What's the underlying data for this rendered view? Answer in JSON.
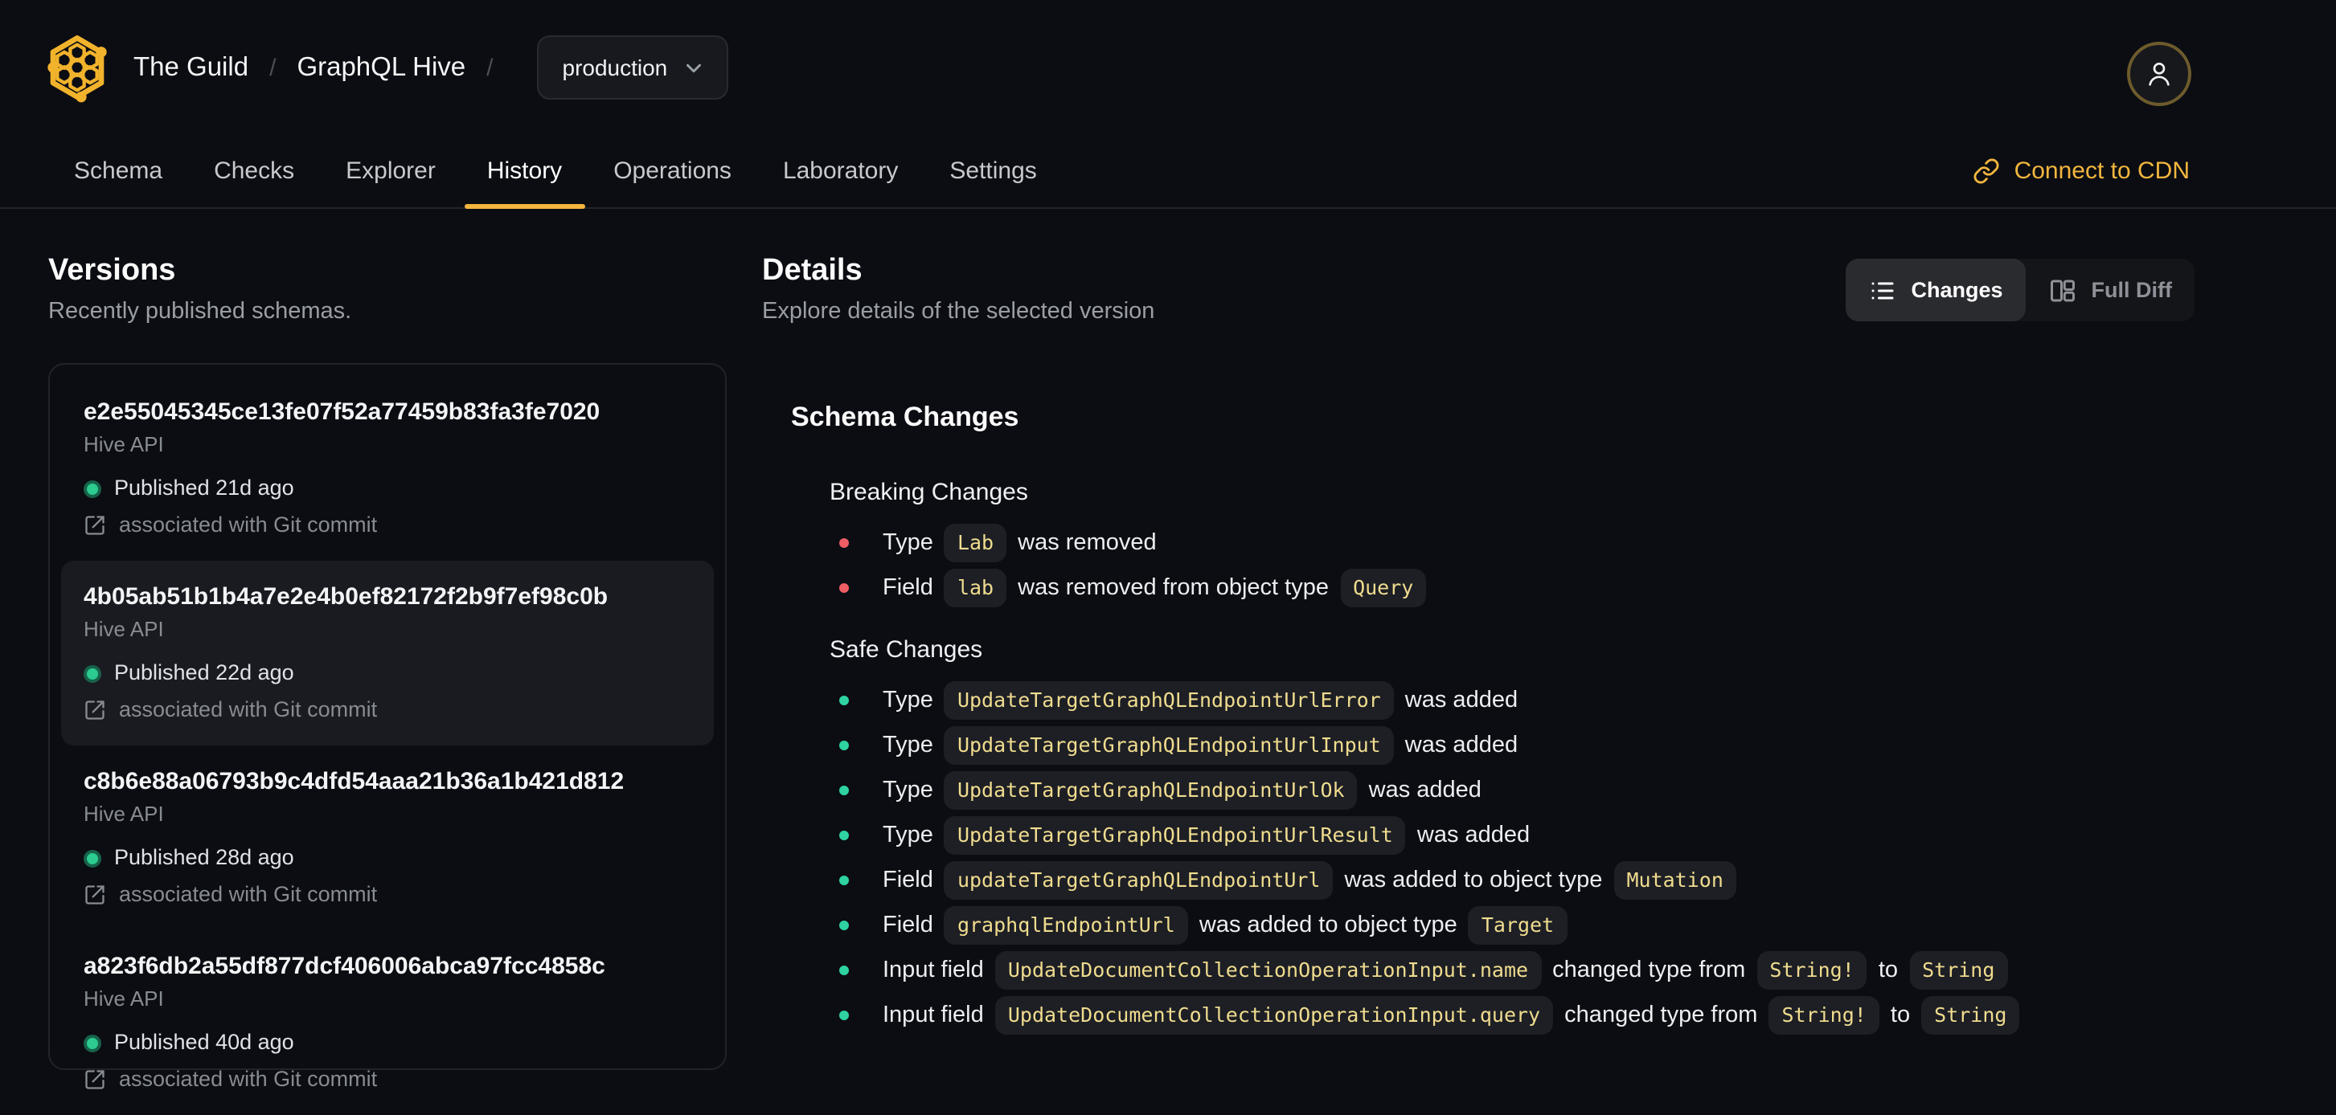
{
  "header": {
    "org": "The Guild",
    "separator": "/",
    "project": "GraphQL Hive",
    "target_selector": {
      "value": "production"
    }
  },
  "nav": {
    "tabs": [
      "Schema",
      "Checks",
      "Explorer",
      "History",
      "Operations",
      "Laboratory",
      "Settings"
    ],
    "active_tab": "History",
    "cdn_link_label": "Connect to CDN"
  },
  "versions": {
    "title": "Versions",
    "subtitle": "Recently published schemas.",
    "items": [
      {
        "hash": "e2e55045345ce13fe07f52a77459b83fa3fe7020",
        "service": "Hive API",
        "status": "Published 21d ago",
        "git": "associated with Git commit",
        "selected": false
      },
      {
        "hash": "4b05ab51b1b4a7e2e4b0ef82172f2b9f7ef98c0b",
        "service": "Hive API",
        "status": "Published 22d ago",
        "git": "associated with Git commit",
        "selected": true
      },
      {
        "hash": "c8b6e88a06793b9c4dfd54aaa21b36a1b421d812",
        "service": "Hive API",
        "status": "Published 28d ago",
        "git": "associated with Git commit",
        "selected": false
      },
      {
        "hash": "a823f6db2a55df877dcf406006abca97fcc4858c",
        "service": "Hive API",
        "status": "Published 40d ago",
        "git": "associated with Git commit",
        "selected": false
      }
    ]
  },
  "details": {
    "title": "Details",
    "subtitle": "Explore details of the selected version",
    "view_toggle": [
      {
        "label": "Changes",
        "icon": "list-icon",
        "active": true
      },
      {
        "label": "Full Diff",
        "icon": "split-panels-icon",
        "active": false
      }
    ],
    "schema_changes": {
      "title": "Schema Changes",
      "sections": [
        {
          "title": "Breaking Changes",
          "kind": "breaking",
          "items": [
            [
              {
                "text": "Type "
              },
              {
                "code": "Lab"
              },
              {
                "text": " was removed"
              }
            ],
            [
              {
                "text": "Field "
              },
              {
                "code": "lab"
              },
              {
                "text": " was removed from object type "
              },
              {
                "code": "Query"
              }
            ]
          ]
        },
        {
          "title": "Safe Changes",
          "kind": "safe",
          "items": [
            [
              {
                "text": "Type "
              },
              {
                "code": "UpdateTargetGraphQLEndpointUrlError"
              },
              {
                "text": " was added"
              }
            ],
            [
              {
                "text": "Type "
              },
              {
                "code": "UpdateTargetGraphQLEndpointUrlInput"
              },
              {
                "text": " was added"
              }
            ],
            [
              {
                "text": "Type "
              },
              {
                "code": "UpdateTargetGraphQLEndpointUrlOk"
              },
              {
                "text": " was added"
              }
            ],
            [
              {
                "text": "Type "
              },
              {
                "code": "UpdateTargetGraphQLEndpointUrlResult"
              },
              {
                "text": " was added"
              }
            ],
            [
              {
                "text": "Field "
              },
              {
                "code": "updateTargetGraphQLEndpointUrl"
              },
              {
                "text": " was added to object type "
              },
              {
                "code": "Mutation"
              }
            ],
            [
              {
                "text": "Field "
              },
              {
                "code": "graphqlEndpointUrl"
              },
              {
                "text": " was added to object type "
              },
              {
                "code": "Target"
              }
            ],
            [
              {
                "text": "Input field "
              },
              {
                "code": "UpdateDocumentCollectionOperationInput.name"
              },
              {
                "text": " changed type from "
              },
              {
                "code": "String!"
              },
              {
                "text": " to "
              },
              {
                "code": "String"
              }
            ],
            [
              {
                "text": "Input field "
              },
              {
                "code": "UpdateDocumentCollectionOperationInput.query"
              },
              {
                "text": " changed type from "
              },
              {
                "code": "String!"
              },
              {
                "text": " to "
              },
              {
                "code": "String"
              }
            ]
          ]
        }
      ]
    }
  },
  "colors": {
    "accent": "#f3b63e",
    "breaking_bullet": "#ee5d64",
    "safe_bullet": "#2fd3a2",
    "published_dot": "#2ccb8f",
    "code_text": "#f0dc8e"
  }
}
